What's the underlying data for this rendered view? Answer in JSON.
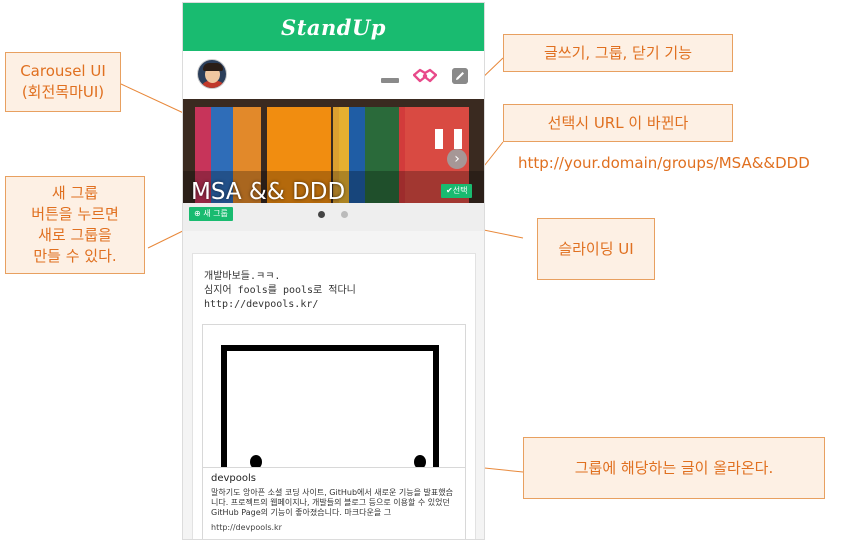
{
  "app": {
    "title": "StandUp"
  },
  "toolbar": {
    "icons": [
      "avatar",
      "minus-icon",
      "handshake-icon",
      "pencil-icon"
    ]
  },
  "carousel": {
    "title": "MSA && DDD",
    "select_label": "선택",
    "next_icon": "chevron-right-icon"
  },
  "slider": {
    "new_group_label": "새 그룹",
    "pages": 2,
    "active_page": 1
  },
  "post": {
    "text": "개발바보들.ㅋㅋ.\n심지어 fools를 pools로 적다니\nhttp://devpools.kr/",
    "link": {
      "title": "devpools",
      "description": "말하기도 앙아픈 소셜 코딩 사이트, GitHub에서 새로운 기능을 발표했습니다. 프로젝트의 웹페이지나, 개발들의 블로그 등으로 이용할 수 있었던 GitHub Page의 기능이 좋아졌습니다. 마크다운을 그",
      "url": "http://devpools.kr"
    }
  },
  "annotations": {
    "carousel": "Carousel UI\n(회전목마UI)",
    "actions": "글쓰기, 그룹, 닫기 기능",
    "select": "선택시 URL 이 바뀐다",
    "url": "http://your.domain/groups/MSA&&DDD",
    "new_group": "새 그룹\n버튼을 누르면\n새로 그룹을\n만들 수 있다.",
    "sliding": "슬라이딩 UI",
    "posts": "그룹에 해당하는 글이 올라온다."
  },
  "colors": {
    "brand_green": "#19bb70",
    "annotation_orange": "#e07020",
    "annotation_bg": "#fdf0e4"
  }
}
